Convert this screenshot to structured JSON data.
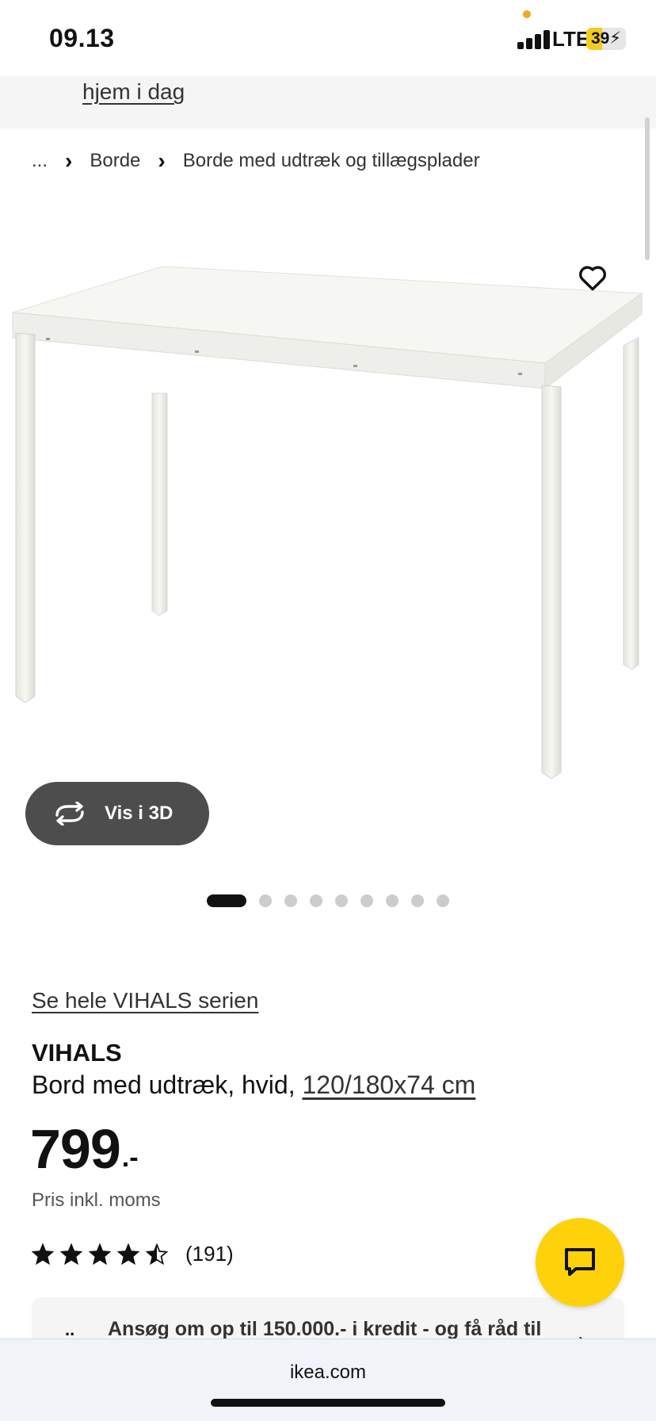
{
  "status_bar": {
    "time": "09.13",
    "network": "LTE",
    "battery_percent": "39",
    "battery_level": 0.39,
    "battery_color": "#f2cc1f"
  },
  "banner": {
    "link_text": "hjem i dag"
  },
  "breadcrumb": {
    "items": [
      "...",
      "Borde",
      "Borde med udtræk og tillægsplader"
    ]
  },
  "gallery": {
    "favorite_icon": "heart-icon",
    "view_3d_label": "Vis i 3D",
    "view_3d_icon": "rotate-3d-icon",
    "total_images": 9,
    "active_index": 0
  },
  "product": {
    "series_link": "Se hele VIHALS serien",
    "name": "VIHALS",
    "description": "Bord med udtræk, hvid,",
    "dimensions": "120/180x74 cm",
    "price": "799",
    "price_suffix": ".-",
    "price_note": "Pris inkl. moms",
    "rating": 4.5,
    "review_count": "(191)"
  },
  "credit": {
    "bullet": "..",
    "text": "Ansøg om op til 150.000.- i kredit - og få råd til",
    "arrow": "›"
  },
  "chat": {
    "icon": "chat-bubble-icon",
    "color": "#fdd20a"
  },
  "browser": {
    "url": "ikea.com"
  }
}
